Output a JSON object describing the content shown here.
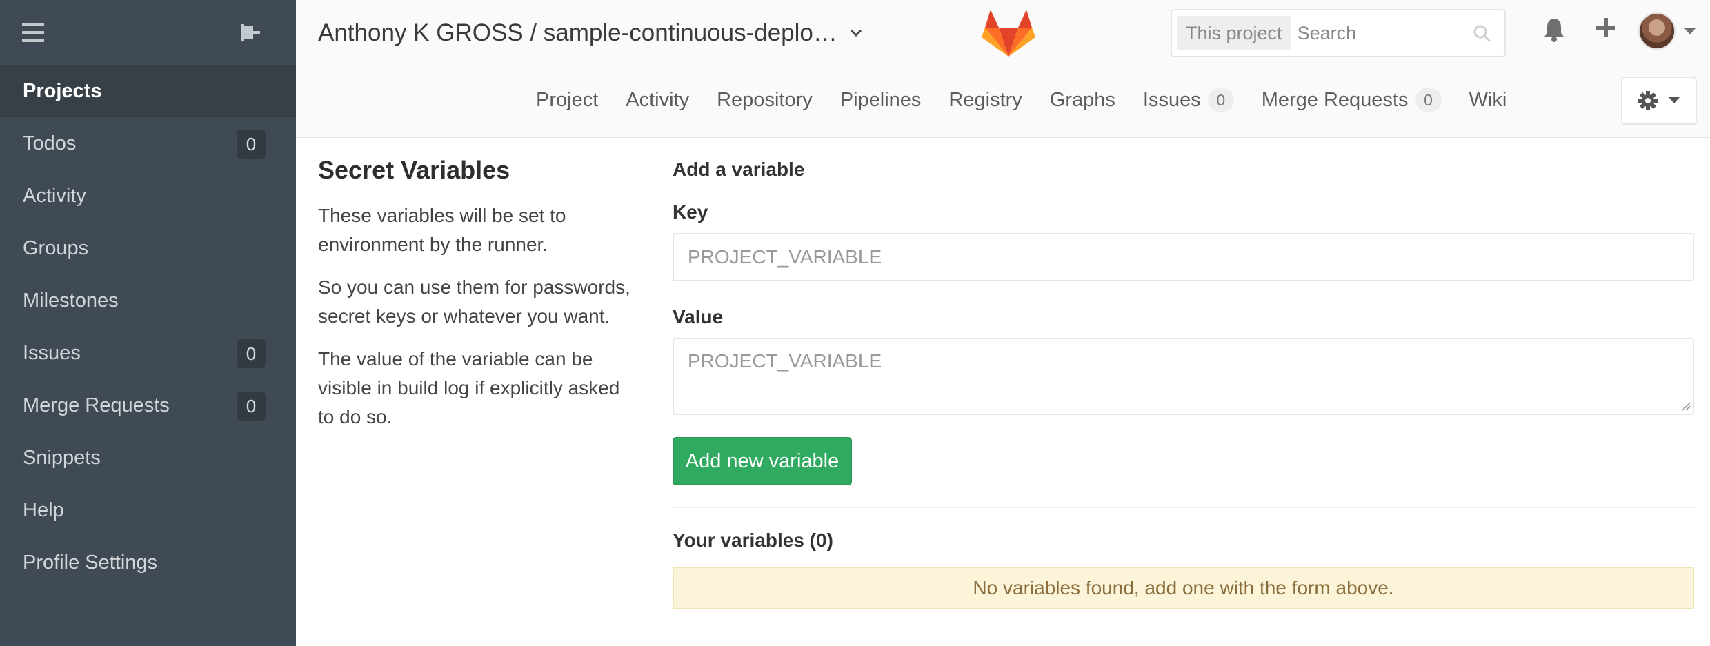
{
  "sidebar": {
    "items": [
      {
        "label": "Projects",
        "count": "",
        "active": true
      },
      {
        "label": "Todos",
        "count": "0"
      },
      {
        "label": "Activity",
        "count": ""
      },
      {
        "label": "Groups",
        "count": ""
      },
      {
        "label": "Milestones",
        "count": ""
      },
      {
        "label": "Issues",
        "count": "0"
      },
      {
        "label": "Merge Requests",
        "count": "0"
      },
      {
        "label": "Snippets",
        "count": ""
      },
      {
        "label": "Help",
        "count": ""
      },
      {
        "label": "Profile Settings",
        "count": ""
      }
    ]
  },
  "header": {
    "project_title": "Anthony K GROSS / sample-continuous-deplo…",
    "search": {
      "scope": "This project",
      "placeholder": "Search"
    },
    "tabs": [
      {
        "label": "Project",
        "badge": ""
      },
      {
        "label": "Activity",
        "badge": ""
      },
      {
        "label": "Repository",
        "badge": ""
      },
      {
        "label": "Pipelines",
        "badge": ""
      },
      {
        "label": "Registry",
        "badge": ""
      },
      {
        "label": "Graphs",
        "badge": ""
      },
      {
        "label": "Issues",
        "badge": "0"
      },
      {
        "label": "Merge Requests",
        "badge": "0"
      },
      {
        "label": "Wiki",
        "badge": ""
      }
    ]
  },
  "secret_variables": {
    "title": "Secret Variables",
    "paragraphs": [
      "These variables will be set to environment by the runner.",
      "So you can use them for passwords, secret keys or whatever you want.",
      "The value of the variable can be visible in build log if explicitly asked to do so."
    ]
  },
  "form": {
    "heading": "Add a variable",
    "key_label": "Key",
    "key_placeholder": "PROJECT_VARIABLE",
    "value_label": "Value",
    "value_placeholder": "PROJECT_VARIABLE",
    "submit_label": "Add new variable"
  },
  "variables": {
    "heading": "Your variables (0)",
    "empty_message": "No variables found, add one with the form above."
  },
  "colors": {
    "sidebar_bg": "#3f4a54",
    "primary_green": "#2faa60",
    "warning_bg": "#fbf4d9"
  }
}
